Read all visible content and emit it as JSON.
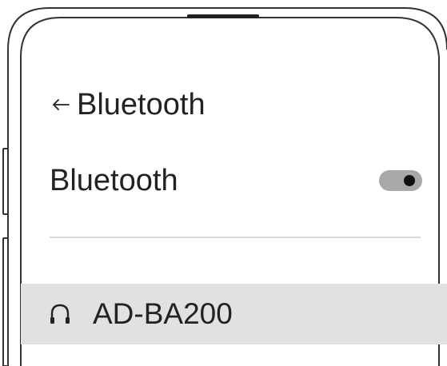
{
  "header": {
    "back_icon": "arrow-left-icon",
    "title": "Bluetooth"
  },
  "bluetooth": {
    "label": "Bluetooth",
    "enabled": true
  },
  "devices": [
    {
      "name": "AD-BA200",
      "icon": "headphones-icon"
    }
  ],
  "colors": {
    "device_row_bg": "#e1e1e1",
    "toggle_track": "#a8a8a8",
    "toggle_knob": "#111111",
    "text": "#222222",
    "frame": "#333333"
  }
}
